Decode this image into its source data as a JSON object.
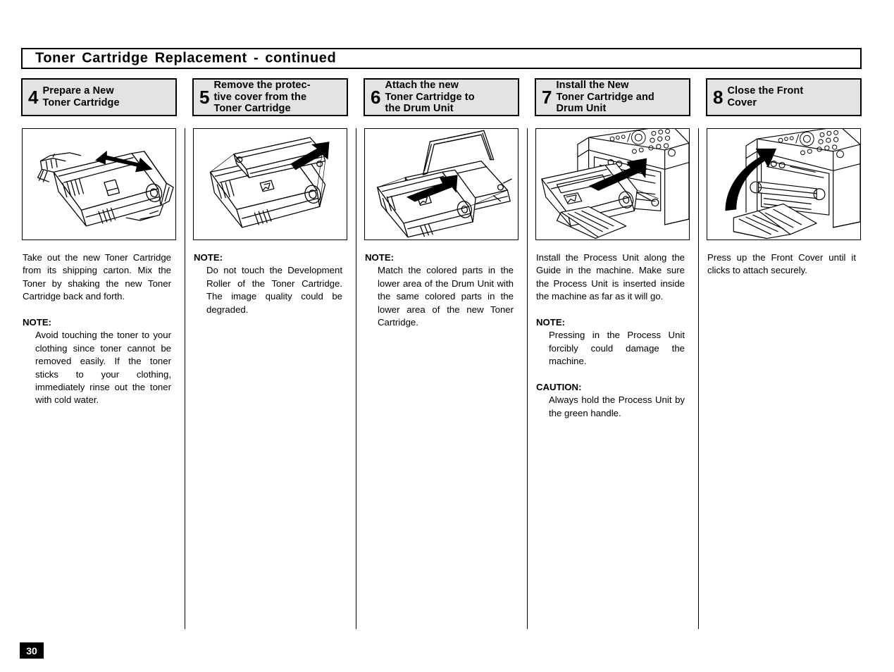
{
  "page": {
    "title": "Toner  Cartridge  Replacement  -  continued",
    "page_number": "30",
    "accent_header_bg": "#e3e3e3",
    "ink_color": "#000000"
  },
  "columns": [
    {
      "step_number": "4",
      "step_title": "Prepare a New\nToner Cartridge",
      "illustration": "toner-cartridge-shake-illustration",
      "paragraph": "Take out the new Toner Cartridge from its shipping carton. Mix the Toner by shaking the new Toner Cartridge back and forth.",
      "note_label": "NOTE:",
      "note_text": "Avoid touching the toner to your clothing since toner cannot be removed easily. If the toner sticks to your clothing, immediately rinse out the toner with cold water.",
      "caution_label": "",
      "caution_text": ""
    },
    {
      "step_number": "5",
      "step_title": "Remove the protec-\ntive cover from the\nToner Cartridge",
      "illustration": "toner-cartridge-remove-cover-illustration",
      "paragraph": "",
      "note_label": "NOTE:",
      "note_text": "Do not touch the Development Roller of the Toner Cartridge. The image quality could be degraded.",
      "caution_label": "",
      "caution_text": ""
    },
    {
      "step_number": "6",
      "step_title": "Attach the new\nToner Cartridge to\nthe Drum Unit",
      "illustration": "toner-cartridge-into-drum-unit-illustration",
      "paragraph": "",
      "note_label": "NOTE:",
      "note_text": "Match the colored parts in the lower area of the Drum Unit with the same colored parts in the lower area of the new Toner Cartridge.",
      "caution_label": "",
      "caution_text": ""
    },
    {
      "step_number": "7",
      "step_title": "Install the New\nToner Cartridge and\nDrum Unit",
      "illustration": "process-unit-into-machine-illustration",
      "paragraph": "Install the Process Unit along the Guide in the machine. Make sure the Process Unit is inserted inside the machine as far as it will go.",
      "note_label": "NOTE:",
      "note_text": "Pressing in the Process Unit forcibly could damage the machine.",
      "caution_label": "CAUTION:",
      "caution_text": "Always hold the Process Unit by the green handle."
    },
    {
      "step_number": "8",
      "step_title": "Close the Front\nCover",
      "illustration": "close-front-cover-illustration",
      "paragraph": "Press up the Front Cover until it clicks to attach securely.",
      "note_label": "",
      "note_text": "",
      "caution_label": "",
      "caution_text": ""
    }
  ]
}
